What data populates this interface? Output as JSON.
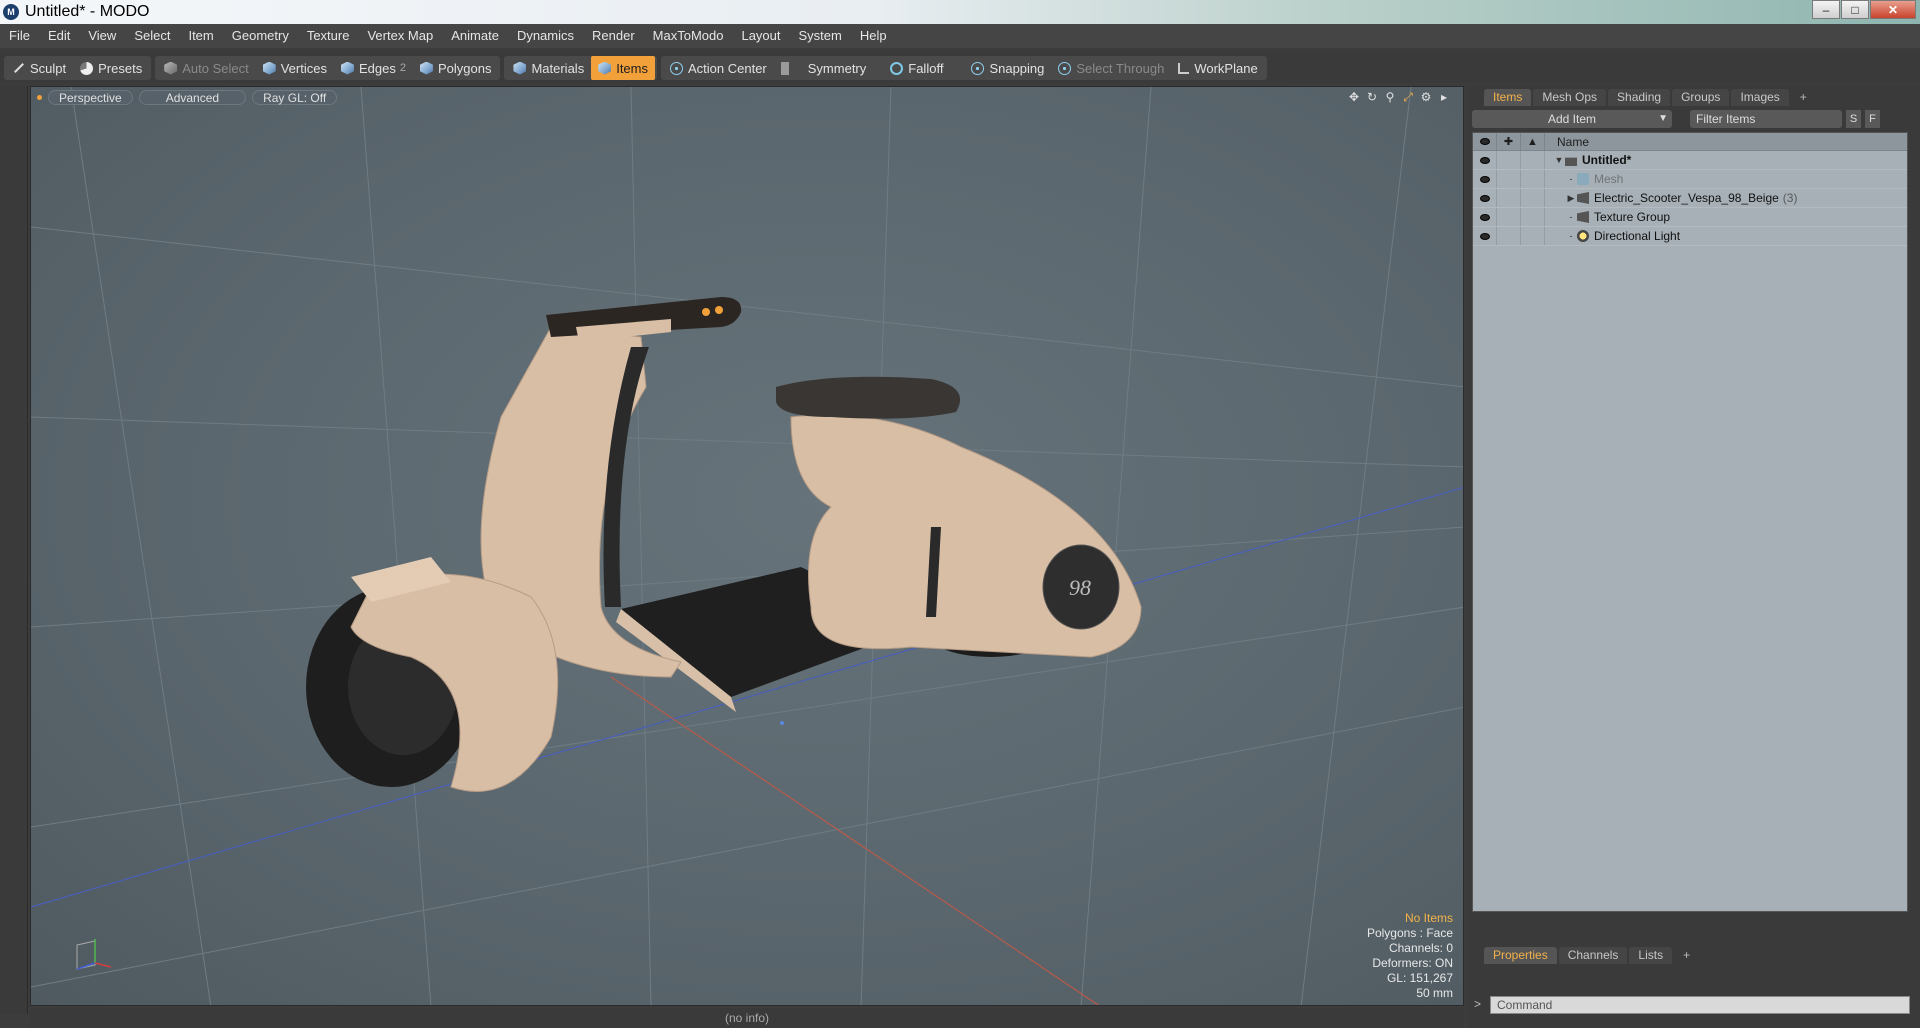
{
  "window": {
    "title": "Untitled* - MODO",
    "app_icon": "modo-logo-icon"
  },
  "menu": [
    "File",
    "Edit",
    "View",
    "Select",
    "Item",
    "Geometry",
    "Texture",
    "Vertex Map",
    "Animate",
    "Dynamics",
    "Render",
    "MaxToModo",
    "Layout",
    "System",
    "Help"
  ],
  "toolbar": {
    "sculpt": "Sculpt",
    "presets": "Presets",
    "auto_select": "Auto Select",
    "vertices": "Vertices",
    "edges": "Edges",
    "edges_count": "2",
    "polygons": "Polygons",
    "materials": "Materials",
    "items": "Items",
    "action_center": "Action Center",
    "symmetry": "Symmetry",
    "falloff": "Falloff",
    "snapping": "Snapping",
    "select_through": "Select Through",
    "workplane": "WorkPlane",
    "active_color": "#f2a13a"
  },
  "viewport": {
    "view": "Perspective",
    "advanced": "Advanced",
    "raygl": "Ray GL: Off",
    "info": {
      "selection": "No Items",
      "polygons": "Polygons : Face",
      "channels": "Channels: 0",
      "deformers": "Deformers: ON",
      "gl": "GL: 151,267",
      "lens": "50 mm"
    },
    "scooter_badge": "98"
  },
  "status": {
    "text": "(no info)"
  },
  "right_panel": {
    "tabs": [
      "Items",
      "Mesh Ops",
      "Shading",
      "Groups",
      "Images"
    ],
    "add_item": "Add Item",
    "filter_items": "Filter Items",
    "s_btn": "S",
    "f_btn": "F",
    "name_header": "Name",
    "items": [
      {
        "label": "Untitled*",
        "kind": "scene"
      },
      {
        "label": "Mesh",
        "kind": "mesh"
      },
      {
        "label": "Electric_Scooter_Vespa_98_Beige",
        "count": "(3)",
        "kind": "group"
      },
      {
        "label": "Texture Group",
        "kind": "group"
      },
      {
        "label": "Directional Light",
        "kind": "light"
      }
    ],
    "bottom_tabs": [
      "Properties",
      "Channels",
      "Lists"
    ],
    "command_placeholder": "Command",
    "command_prompt": ">"
  }
}
